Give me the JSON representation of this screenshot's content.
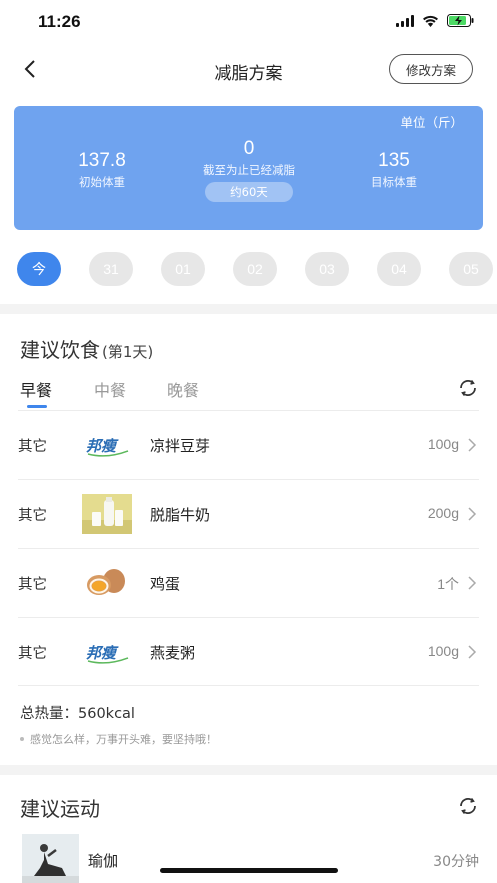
{
  "status_bar": {
    "time": "11:26"
  },
  "nav": {
    "title": "减脂方案",
    "modify_label": "修改方案"
  },
  "summary": {
    "unit": "单位（斤）",
    "initial_weight": "137.8",
    "initial_label": "初始体重",
    "lost_weight": "0",
    "lost_label": "截至为止已经减脂",
    "days_estimate": "约60天",
    "target_weight": "135",
    "target_label": "目标体重"
  },
  "days": [
    {
      "label": "今",
      "active": true
    },
    {
      "label": "31",
      "active": false
    },
    {
      "label": "01",
      "active": false
    },
    {
      "label": "02",
      "active": false
    },
    {
      "label": "03",
      "active": false
    },
    {
      "label": "04",
      "active": false
    },
    {
      "label": "05",
      "active": false
    }
  ],
  "diet": {
    "title": "建议饮食",
    "subtitle": "(第1天)",
    "tabs": [
      "早餐",
      "中餐",
      "晚餐"
    ],
    "active_tab": 0,
    "items": [
      {
        "category": "其它",
        "name": "凉拌豆芽",
        "amount": "100g",
        "thumb": "brand-logo"
      },
      {
        "category": "其它",
        "name": "脱脂牛奶",
        "amount": "200g",
        "thumb": "milk"
      },
      {
        "category": "其它",
        "name": "鸡蛋",
        "amount": "1个",
        "thumb": "eggs"
      },
      {
        "category": "其它",
        "name": "燕麦粥",
        "amount": "100g",
        "thumb": "brand-logo"
      }
    ],
    "brand_logo_text": "邦瘦",
    "total": "总热量：560kcal",
    "tip": "感觉怎么样，万事开头难，要坚持哦！"
  },
  "exercise": {
    "title": "建议运动",
    "items": [
      {
        "name": "瑜伽",
        "duration": "30分钟"
      }
    ]
  },
  "colors": {
    "accent": "#3f86ec",
    "summary_bg": "#6fa3ef"
  }
}
